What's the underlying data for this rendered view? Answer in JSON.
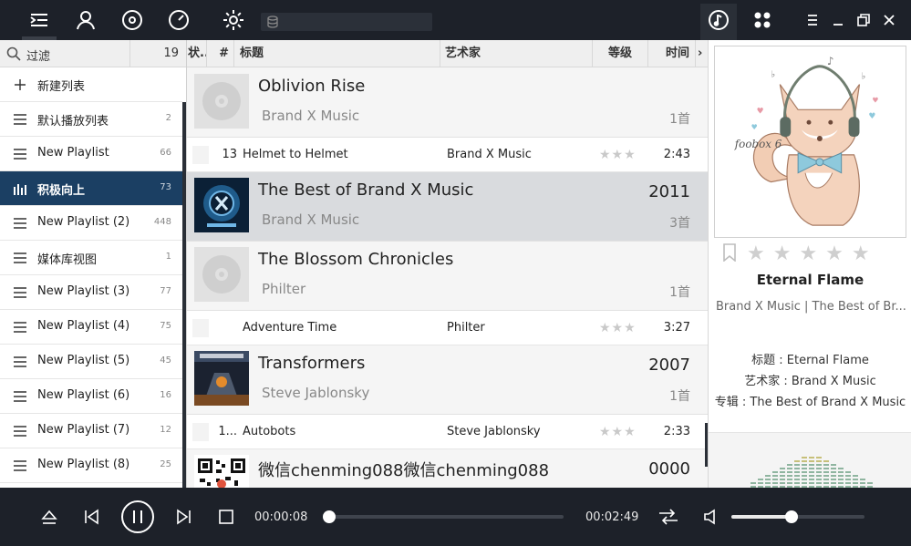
{
  "top_bar": {
    "icons": [
      "menu-icon",
      "user-icon",
      "disc-icon",
      "gauge-icon",
      "gear-icon",
      "database-icon",
      "music-note-icon",
      "grid-icon",
      "hamburger-icon",
      "minimize-icon",
      "restore-icon",
      "close-icon"
    ],
    "colors": {
      "background": "#1d2129",
      "icon": "#ffffff"
    }
  },
  "sidebar": {
    "filter_label": "过滤",
    "filter_count": "19",
    "new_playlist_label": "新建列表",
    "playlists": [
      {
        "name": "默认播放列表",
        "count": "2"
      },
      {
        "name": "New Playlist",
        "count": "66"
      },
      {
        "name": "积极向上",
        "count": "73",
        "active": true
      },
      {
        "name": "New Playlist (2)",
        "count": "448"
      },
      {
        "name": "媒体库视图",
        "count": "1"
      },
      {
        "name": "New Playlist (3)",
        "count": "77"
      },
      {
        "name": "New Playlist (4)",
        "count": "75"
      },
      {
        "name": "New Playlist (5)",
        "count": "45"
      },
      {
        "name": "New Playlist (6)",
        "count": "16"
      },
      {
        "name": "New Playlist (7)",
        "count": "12"
      },
      {
        "name": "New Playlist (8)",
        "count": "25"
      }
    ],
    "active_color": "#1b3f63"
  },
  "tracklist": {
    "columns": {
      "status": "状..",
      "number": "#",
      "title": "标题",
      "artist": "艺术家",
      "rating": "等级",
      "duration": "时间",
      "more": "›"
    },
    "groups": [
      {
        "title": "Oblivion Rise",
        "artist": "Brand X Music",
        "year": "",
        "count": "1首",
        "art": "placeholder-disc"
      },
      {
        "title": "The Best of Brand X Music",
        "artist": "Brand X Music",
        "year": "2011",
        "count": "3首",
        "art": "brand-x-cover",
        "selected": true
      },
      {
        "title": "The Blossom Chronicles",
        "artist": "Philter",
        "year": "",
        "count": "1首",
        "art": "placeholder-disc"
      },
      {
        "title": "Transformers",
        "artist": "Steve Jablonsky",
        "year": "2007",
        "count": "1首",
        "art": "transformers-cover"
      },
      {
        "title": "微信chenming088微信chenming088",
        "artist": "",
        "year": "0000",
        "count": "",
        "art": "qr-code"
      }
    ],
    "tracks": [
      {
        "number": "13",
        "title": "Helmet to Helmet",
        "artist": "Brand X Music",
        "rating": "★★★",
        "time": "2:43"
      },
      {
        "number": "",
        "title": "Adventure Time",
        "artist": "Philter",
        "rating": "★★★",
        "time": "3:27"
      },
      {
        "number": "1...",
        "title": "Autobots",
        "artist": "Steve Jablonsky",
        "rating": "★★★",
        "time": "2:33"
      }
    ]
  },
  "now_playing": {
    "cover_text": "foobox 6",
    "rating_stars": "★★★★★",
    "title": "Eternal Flame",
    "subtitle": "Brand X Music  |  The Best of Br...",
    "meta_title": "标题 : Eternal Flame",
    "meta_artist": "艺术家 : Brand X Music",
    "meta_album": "专辑 : The Best of Brand X Music"
  },
  "player": {
    "current_time": "00:00:08",
    "total_time": "00:02:49",
    "progress": 0.02,
    "volume": 0.45,
    "controls": [
      "eject-icon",
      "previous-icon",
      "pause-icon",
      "next-icon",
      "stop-icon",
      "repeat-icon",
      "volume-icon"
    ]
  }
}
